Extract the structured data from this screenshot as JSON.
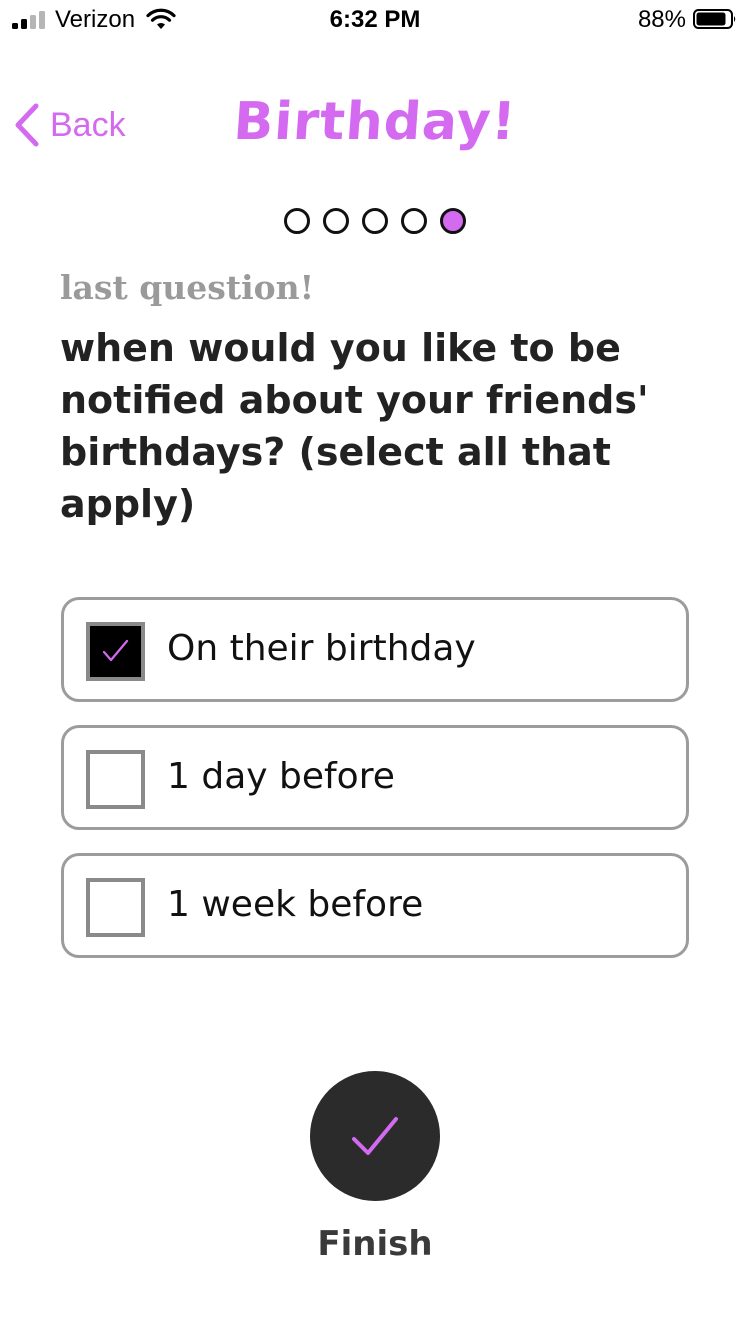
{
  "status_bar": {
    "carrier": "Verizon",
    "time": "6:32 PM",
    "battery_percent": "88%",
    "battery_level": 0.88,
    "signal_bars": 2,
    "signal_icon": "cellular-signal-icon",
    "wifi_icon": "wifi-icon",
    "battery_icon": "battery-icon"
  },
  "nav": {
    "back_label": "Back",
    "back_icon": "chevron-left-icon",
    "title": "Birthday!"
  },
  "progress": {
    "total_steps": 5,
    "current_step": 5
  },
  "question": {
    "eyebrow": "last question!",
    "text": "when would you like to be notified about your friends' birthdays? (select all that apply)"
  },
  "options": [
    {
      "label": "On their birthday",
      "checked": true
    },
    {
      "label": "1 day before",
      "checked": false
    },
    {
      "label": "1 week before",
      "checked": false
    }
  ],
  "finish": {
    "label": "Finish",
    "icon": "checkmark-icon"
  },
  "colors": {
    "accent": "#d36af0",
    "text_dark": "#222222",
    "muted": "#9a9a9a",
    "option_border": "#9c9c9c",
    "finish_bg": "#2b2b2b"
  }
}
